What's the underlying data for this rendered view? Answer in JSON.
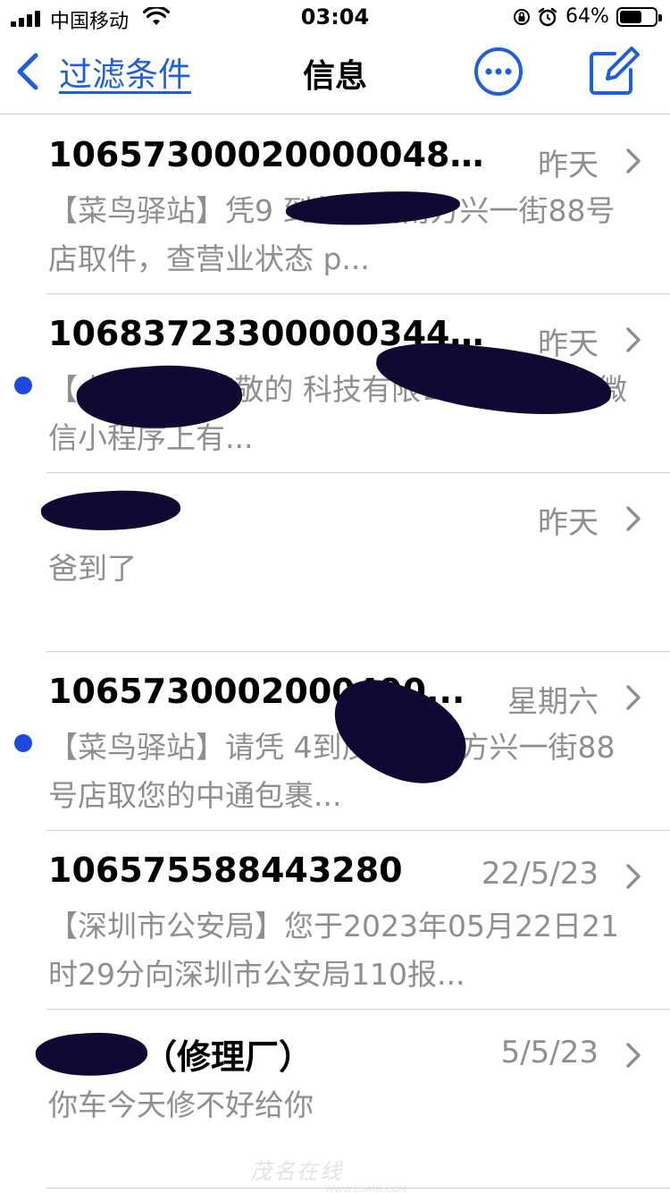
{
  "status_bar": {
    "carrier": "中国移动",
    "time": "03:04",
    "battery_percent": "64%",
    "battery_level": 0.64,
    "icons": [
      "signal-icon",
      "wifi-icon",
      "orientation-lock-icon",
      "alarm-icon",
      "battery-icon"
    ]
  },
  "nav": {
    "back_label": "过滤条件",
    "title": "信息",
    "icons": [
      "chevron-left-icon",
      "more-icon",
      "compose-icon"
    ]
  },
  "messages": [
    {
      "sender": "106573000200000482012",
      "date": "昨天",
      "preview": "【菜鸟驿站】凭9 到茂名茂南方兴一街88号店取件，查营业状态 p...",
      "unread": false
    },
    {
      "sender": "1068372330000034449 1",
      "date": "昨天",
      "preview": "【 招聘网】尊敬的 科技有限公司：提醒您微信小程序上有...",
      "unread": true
    },
    {
      "sender": "",
      "date": "昨天",
      "preview": "爸到了",
      "unread": false
    },
    {
      "sender": "1065730002000490...",
      "date": "星期六",
      "preview": "【菜鸟驿站】请凭 4到茂名茂南方兴一街88号店取您的中通包裹...",
      "unread": true
    },
    {
      "sender": "106575588443280",
      "date": "22/5/23",
      "preview": "【深圳市公安局】您于2023年05月22日21时29分向深圳市公安局110报...",
      "unread": false
    },
    {
      "sender": "（修理厂）",
      "date": "5/5/23",
      "preview": "你车今天修不好给你",
      "unread": false
    }
  ],
  "watermark": {
    "text": "茂名在线",
    "url": "WWW.GDMM.COM"
  },
  "colors": {
    "accent": "#1f5fdb",
    "unread_dot": "#1f48e0",
    "secondary_text": "#8e8e93",
    "separator": "#d0d0d4"
  }
}
